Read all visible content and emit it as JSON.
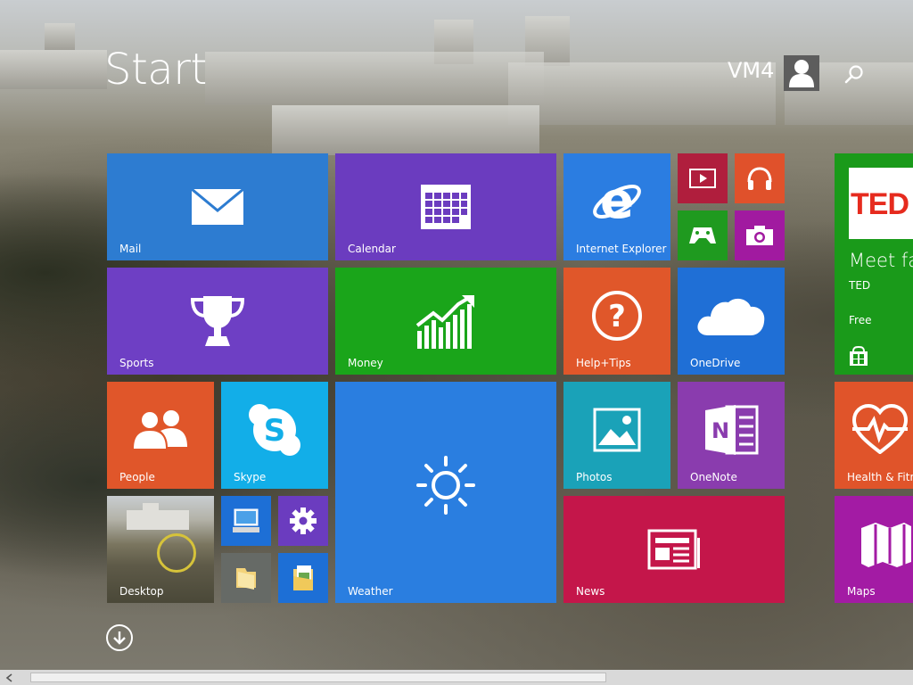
{
  "header": {
    "title": "Start",
    "user_name": "VM4"
  },
  "tiles": {
    "mail": {
      "label": "Mail",
      "color": "#2d7cd1"
    },
    "calendar": {
      "label": "Calendar",
      "color": "#6b3cbf"
    },
    "internet_explorer": {
      "label": "Internet Explorer",
      "color": "#2b7de1"
    },
    "video": {
      "color": "#b01e3d"
    },
    "music": {
      "color": "#e0512b"
    },
    "games": {
      "color": "#1f9a1f"
    },
    "camera": {
      "color": "#a11aa0"
    },
    "sports": {
      "label": "Sports",
      "color": "#6e3fc4"
    },
    "money": {
      "label": "Money",
      "color": "#1aa51a"
    },
    "help_tips": {
      "label": "Help+Tips",
      "color": "#e0572a"
    },
    "onedrive": {
      "label": "OneDrive",
      "color": "#1f6fd6"
    },
    "people": {
      "label": "People",
      "color": "#e0562a"
    },
    "skype": {
      "label": "Skype",
      "color": "#12aee8"
    },
    "weather": {
      "label": "Weather",
      "color": "#2a7ee0"
    },
    "photos": {
      "label": "Photos",
      "color": "#1aa2b8"
    },
    "onenote": {
      "label": "OneNote",
      "color": "#8a3cae"
    },
    "desktop": {
      "label": "Desktop"
    },
    "this_pc": {
      "color": "#1d6fd6"
    },
    "settings": {
      "color": "#6b3cbf"
    },
    "file_explorer": {
      "color": "#666a66"
    },
    "documents": {
      "color": "#1d6fd6"
    },
    "news": {
      "label": "News",
      "color": "#c4164a"
    },
    "ted": {
      "headline": "Meet fas",
      "publisher": "TED",
      "price": "Free",
      "color": "#1a9a1a"
    },
    "health_fitness": {
      "label": "Health & Fitne",
      "color": "#e0542a"
    },
    "maps": {
      "label": "Maps",
      "color": "#a31ba4"
    }
  }
}
